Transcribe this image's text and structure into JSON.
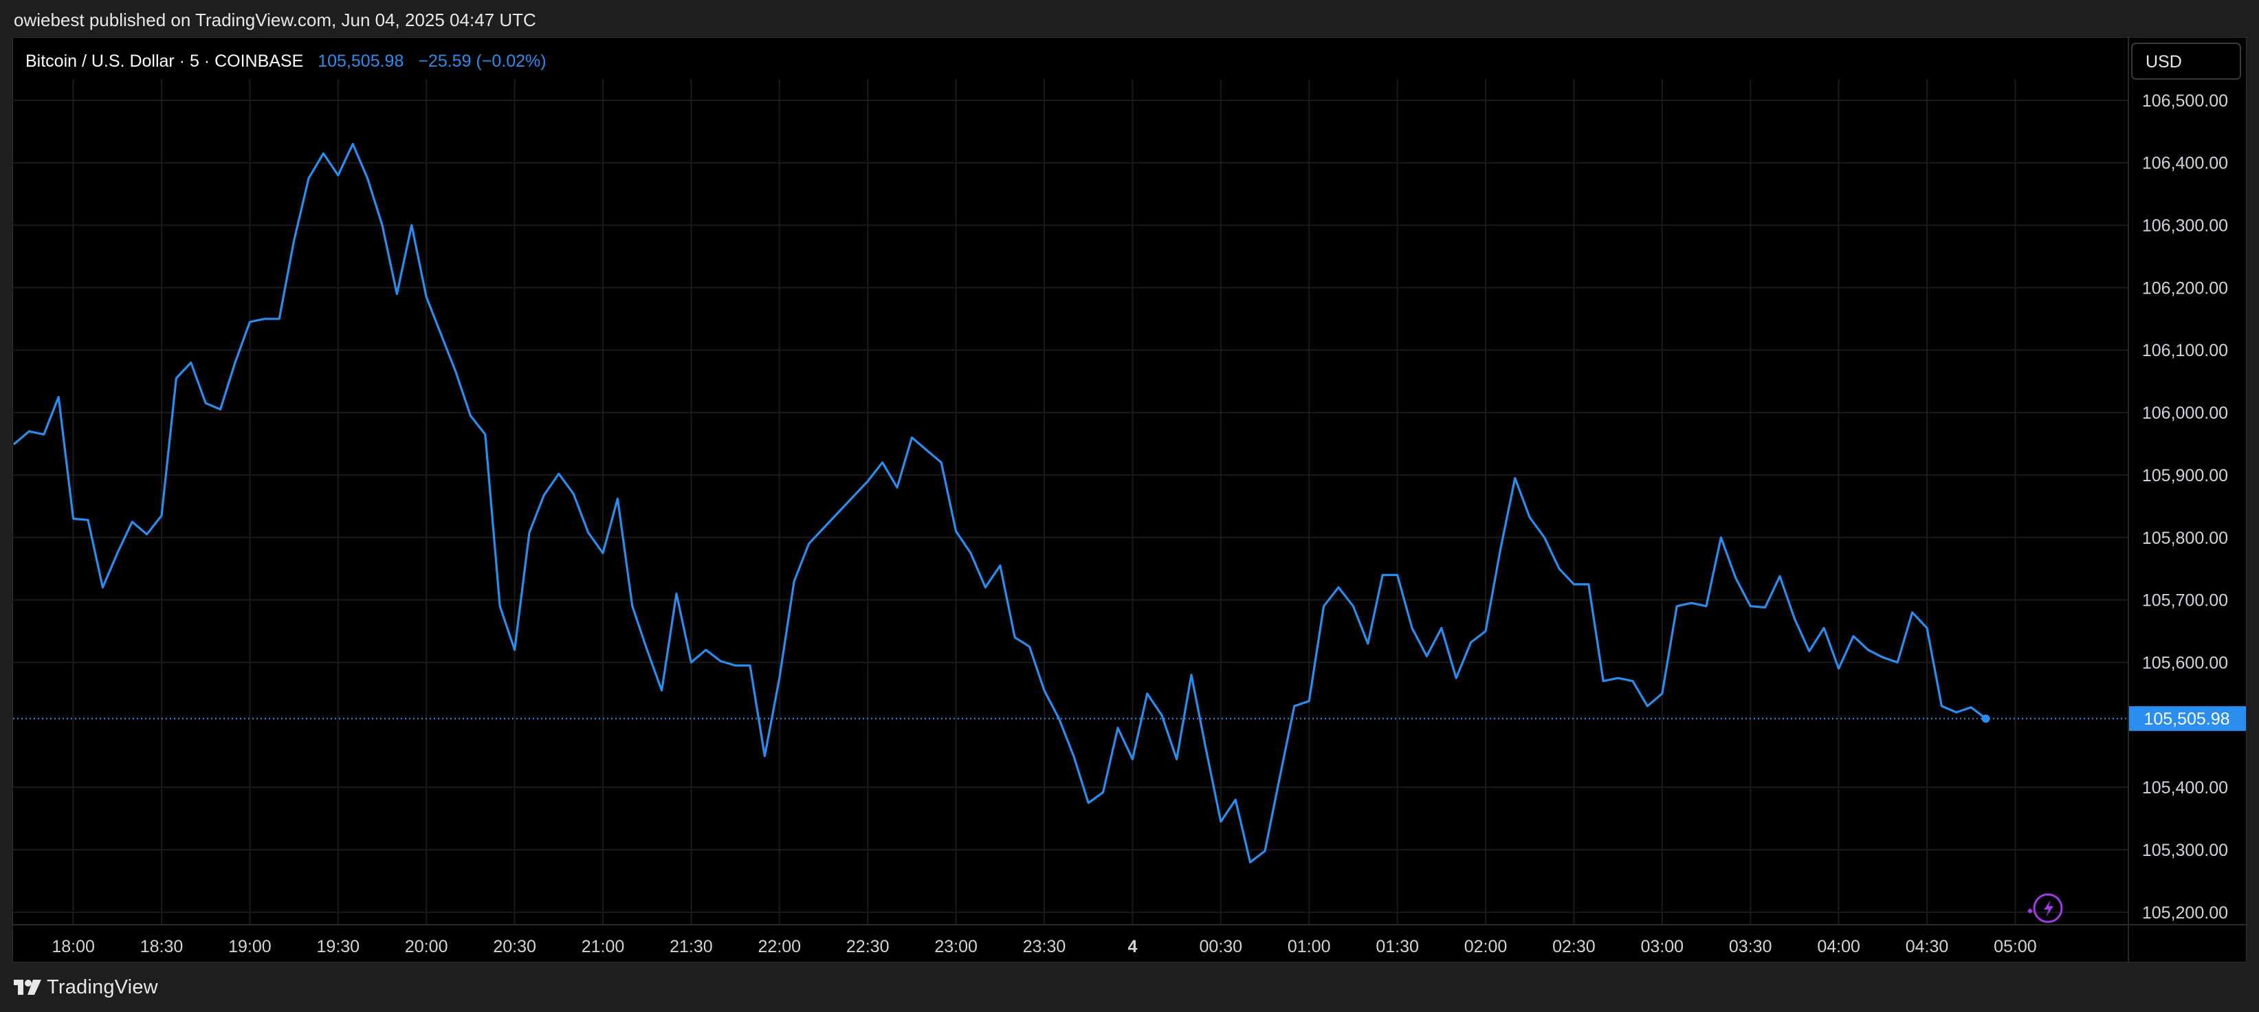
{
  "header": {
    "published_text": "owiebest published on TradingView.com, Jun 04, 2025 04:47 UTC"
  },
  "legend": {
    "symbol": "Bitcoin / U.S. Dollar · 5 · COINBASE",
    "price": "105,505.98",
    "change": "−25.59 (−0.02%)"
  },
  "currency_button": {
    "label": "USD"
  },
  "last_price_label": "105,505.98",
  "footer": {
    "brand": "TradingView"
  },
  "icons": {
    "brand_logo": "tradingview-logo-icon",
    "flash": "lightning-bolt-icon"
  },
  "colors": {
    "line": "#2a8df0",
    "price_tag_bg": "#2a8df0",
    "text": "#e8e8e8",
    "axis_text": "#d1d4dc",
    "grid": "#1a1a1a",
    "background": "#000000"
  },
  "chart_data": {
    "type": "line",
    "title": "Bitcoin / U.S. Dollar · 5 · COINBASE",
    "xlabel": "",
    "ylabel": "",
    "interval_minutes": 5,
    "x_start": "Jun 03 17:40 UTC",
    "x_end": "Jun 04 04:45 UTC",
    "ylim": [
      105180,
      106600
    ],
    "grid": true,
    "y_ticks": [
      "106,500.00",
      "106,400.00",
      "106,300.00",
      "106,200.00",
      "106,100.00",
      "106,000.00",
      "105,900.00",
      "105,800.00",
      "105,700.00",
      "105,600.00",
      "105,400.00",
      "105,300.00",
      "105,200.00"
    ],
    "x_ticks": [
      "18:00",
      "18:30",
      "19:00",
      "19:30",
      "20:00",
      "20:30",
      "21:00",
      "21:30",
      "22:00",
      "22:30",
      "23:00",
      "23:30",
      "4",
      "00:30",
      "01:00",
      "01:30",
      "02:00",
      "02:30",
      "03:00",
      "03:30",
      "04:00",
      "04:30",
      "05:00"
    ],
    "values": [
      105950,
      105970,
      105965,
      106025,
      105830,
      105828,
      105720,
      105775,
      105825,
      105805,
      105835,
      106055,
      106080,
      106015,
      106005,
      106080,
      106145,
      106150,
      106150,
      106275,
      106375,
      106415,
      106380,
      106430,
      106375,
      106300,
      106190,
      106300,
      106185,
      106125,
      106065,
      105995,
      105965,
      105690,
      105620,
      105808,
      105868,
      105902,
      105870,
      105808,
      105775,
      105862,
      105690,
      105620,
      105555,
      105710,
      105600,
      105620,
      105602,
      105595,
      105595,
      105450,
      105575,
      105730,
      105790,
      105815,
      105840,
      105865,
      105890,
      105920,
      105880,
      105960,
      105940,
      105920,
      105810,
      105775,
      105720,
      105755,
      105640,
      105625,
      105555,
      105510,
      105450,
      105375,
      105392,
      105495,
      105445,
      105550,
      105515,
      105445,
      105580,
      105460,
      105345,
      105380,
      105280,
      105298,
      105415,
      105530,
      105538,
      105690,
      105720,
      105690,
      105630,
      105740,
      105740,
      105655,
      105610,
      105655,
      105575,
      105632,
      105650,
      105780,
      105895,
      105832,
      105800,
      105750,
      105725,
      105725,
      105570,
      105575,
      105570,
      105530,
      105550,
      105690,
      105695,
      105690,
      105800,
      105735,
      105690,
      105688,
      105738,
      105670,
      105618,
      105655,
      105590,
      105642,
      105620,
      105608,
      105600,
      105680,
      105655,
      105530,
      105520,
      105528,
      105510
    ]
  }
}
